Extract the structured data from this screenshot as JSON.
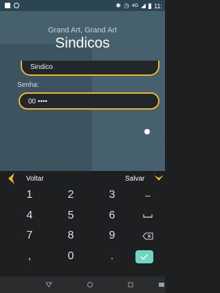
{
  "statusbar": {
    "network": "4G",
    "time": "11:"
  },
  "header": {
    "subtitle": "Grand Art, Grand Art",
    "title": "Sindicos"
  },
  "form": {
    "field1_value": "Sindico",
    "password_label": "Senha:",
    "password_value": "00 ••••"
  },
  "keyboard": {
    "back_label": "Voltar",
    "save_label": "Salvar",
    "rows": [
      [
        "1",
        "2",
        "3",
        "–"
      ],
      [
        "4",
        "5",
        "6",
        "⎵"
      ],
      [
        "7",
        "8",
        "9",
        "⌫"
      ],
      [
        ",",
        "0",
        ".",
        "enter"
      ]
    ]
  },
  "colors": {
    "accent": "#f5b32e",
    "enter": "#6fd6c4",
    "app_bg": "#47606e"
  },
  "icons": {
    "back": "chevron-left-icon",
    "save": "chevron-down-icon",
    "space": "space-icon",
    "backspace": "backspace-icon",
    "enter": "check-icon"
  }
}
